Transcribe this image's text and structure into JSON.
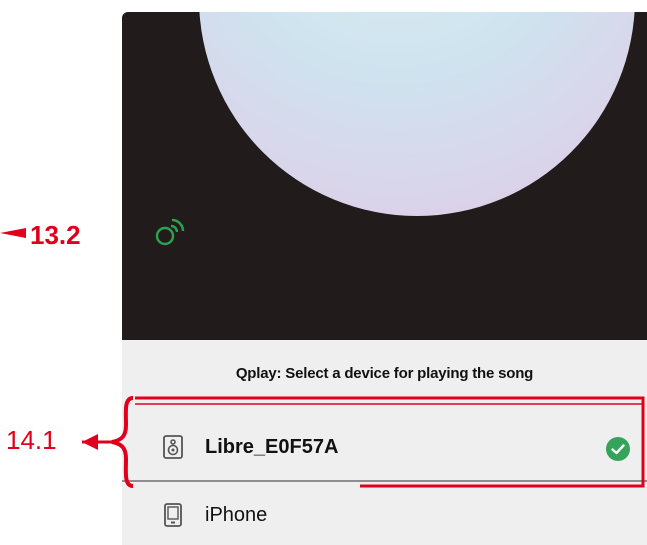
{
  "sheet": {
    "title": "Qplay: Select a device for playing the song",
    "devices": [
      {
        "label": "Libre_E0F57A",
        "icon": "speaker-icon",
        "selected": true
      },
      {
        "label": "iPhone",
        "icon": "phone-icon",
        "selected": false
      }
    ]
  },
  "annotations": {
    "cast_label": "13.2",
    "device_label": "14.1"
  },
  "colors": {
    "background_dark": "#211c1b",
    "sheet": "#efefef",
    "cast_icon": "#2ca24d",
    "check": "#35a35a",
    "annotation": "#e0001b",
    "note_purple": "#8f5df7",
    "note_magenta": "#ea08f0"
  }
}
